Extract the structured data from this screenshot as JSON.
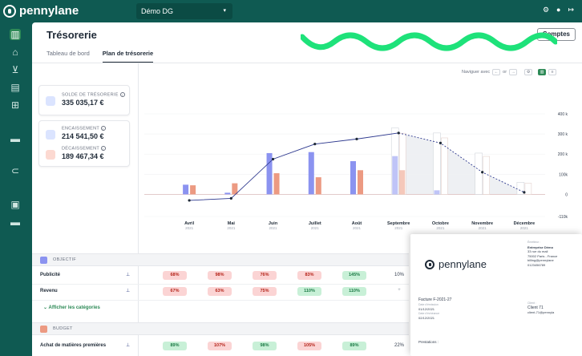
{
  "app": {
    "brand": "pennylane",
    "company": "Démo DG"
  },
  "page": {
    "title": "Trésorerie",
    "comptes_button": "Comptes"
  },
  "tabs": [
    {
      "label": "Tableau de bord",
      "active": false
    },
    {
      "label": "Plan de trésorerie",
      "active": true
    }
  ],
  "balances": {
    "solde_label": "SOLDE DE TRÉSORERIE",
    "solde_value": "335 035,17 €",
    "encaissement_label": "ENCAISSEMENT",
    "encaissement_value": "214 541,50 €",
    "decaissement_label": "DÉCAISSEMENT",
    "decaissement_value": "189 467,34 €"
  },
  "toolbar": {
    "navigate_label": "Naviguer avec",
    "key_left": "←",
    "or": "or",
    "key_right": "→"
  },
  "chart_data": {
    "type": "bar",
    "categories": [
      "Avril",
      "Mai",
      "Juin",
      "Juillet",
      "Août",
      "Septembre",
      "Octobre",
      "Novembre",
      "Décembre"
    ],
    "years": [
      "2021",
      "2021",
      "2021",
      "2021",
      "2021",
      "2021",
      "2021",
      "2021",
      "2021"
    ],
    "y_ticks": [
      "400 k",
      "300 k",
      "200 k",
      "100k",
      "0",
      "-110k"
    ],
    "ylim": [
      -110,
      400
    ],
    "series": [
      {
        "kind": "bar",
        "color": "#8b93f0",
        "values": [
          48,
          8,
          205,
          210,
          165,
          190,
          20,
          0,
          0
        ]
      },
      {
        "kind": "bar",
        "color": "#ec9a82",
        "values": [
          45,
          55,
          105,
          85,
          120,
          120,
          0,
          0,
          0
        ]
      },
      {
        "kind": "bar-projected",
        "color": "#ffffff",
        "values": [
          0,
          0,
          0,
          0,
          0,
          330,
          305,
          205,
          60
        ]
      },
      {
        "kind": "line",
        "color": "#2f3a8f",
        "values": [
          -30,
          -20,
          175,
          250,
          275,
          305,
          255,
          110,
          10
        ]
      }
    ],
    "grid": true
  },
  "table": {
    "objectif_label": "OBJECTIF",
    "rows": [
      {
        "label": "Publicité",
        "values": [
          "68%",
          "98%",
          "76%",
          "83%",
          "145%"
        ],
        "colors": [
          "red",
          "red",
          "red",
          "red",
          "green"
        ],
        "extra": "10%"
      },
      {
        "label": "Revenu",
        "values": [
          "67%",
          "63%",
          "75%",
          "110%",
          "110%"
        ],
        "colors": [
          "red",
          "red",
          "red",
          "green",
          "green"
        ],
        "extra": "+"
      }
    ],
    "show_categories": "Afficher les catégories",
    "budget_label": "BUDGET",
    "budget_rows": [
      {
        "label": "Achat de matières premières",
        "values": [
          "89%",
          "107%",
          "98%",
          "105%",
          "89%"
        ],
        "colors": [
          "green",
          "red",
          "green",
          "red",
          "green"
        ],
        "extra": "22%"
      }
    ]
  },
  "invoice": {
    "brand": "pennylane",
    "issuer_caption": "Émetteur :",
    "issuer_name": "Entreprise Démo",
    "issuer_addr1": "33 rue du mail",
    "issuer_addr2": "75002 Paris - France",
    "issuer_email": "billing@pennylane",
    "issuer_phone": "0123456789",
    "number": "Facture F-2021-27",
    "date_caption": "Date d'émission",
    "date": "01/12/2021",
    "due_caption": "Date d'échéance",
    "due": "02/12/2021",
    "client_caption": "Client :",
    "client_name": "Client 71",
    "client_email": "client-71@pennyla",
    "prestations": "Prestations :"
  }
}
